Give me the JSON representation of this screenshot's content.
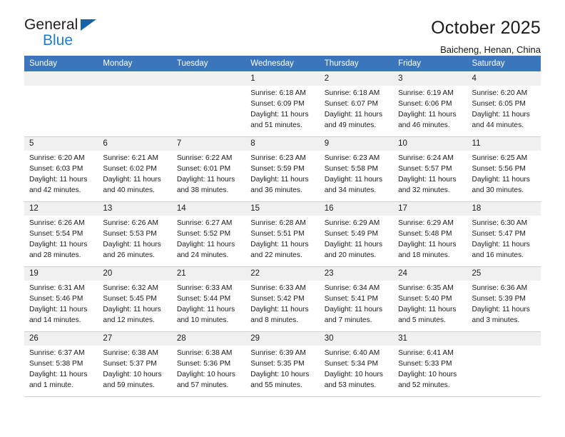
{
  "logo": {
    "line1": "General",
    "line2": "Blue",
    "triangle_icon": "triangle-icon"
  },
  "header": {
    "title": "October 2025",
    "subtitle": "Baicheng, Henan, China"
  },
  "colors": {
    "header_blue": "#3b76bc",
    "logo_blue": "#1b7fd4",
    "daynum_band": "#f0f0f0",
    "cell_border": "#cfcfcf"
  },
  "weekday_headers": [
    "Sunday",
    "Monday",
    "Tuesday",
    "Wednesday",
    "Thursday",
    "Friday",
    "Saturday"
  ],
  "weeks": [
    [
      {
        "empty": true
      },
      {
        "empty": true
      },
      {
        "empty": true
      },
      {
        "day": "1",
        "sunrise": "Sunrise: 6:18 AM",
        "sunset": "Sunset: 6:09 PM",
        "daylight": "Daylight: 11 hours and 51 minutes."
      },
      {
        "day": "2",
        "sunrise": "Sunrise: 6:18 AM",
        "sunset": "Sunset: 6:07 PM",
        "daylight": "Daylight: 11 hours and 49 minutes."
      },
      {
        "day": "3",
        "sunrise": "Sunrise: 6:19 AM",
        "sunset": "Sunset: 6:06 PM",
        "daylight": "Daylight: 11 hours and 46 minutes."
      },
      {
        "day": "4",
        "sunrise": "Sunrise: 6:20 AM",
        "sunset": "Sunset: 6:05 PM",
        "daylight": "Daylight: 11 hours and 44 minutes."
      }
    ],
    [
      {
        "day": "5",
        "sunrise": "Sunrise: 6:20 AM",
        "sunset": "Sunset: 6:03 PM",
        "daylight": "Daylight: 11 hours and 42 minutes."
      },
      {
        "day": "6",
        "sunrise": "Sunrise: 6:21 AM",
        "sunset": "Sunset: 6:02 PM",
        "daylight": "Daylight: 11 hours and 40 minutes."
      },
      {
        "day": "7",
        "sunrise": "Sunrise: 6:22 AM",
        "sunset": "Sunset: 6:01 PM",
        "daylight": "Daylight: 11 hours and 38 minutes."
      },
      {
        "day": "8",
        "sunrise": "Sunrise: 6:23 AM",
        "sunset": "Sunset: 5:59 PM",
        "daylight": "Daylight: 11 hours and 36 minutes."
      },
      {
        "day": "9",
        "sunrise": "Sunrise: 6:23 AM",
        "sunset": "Sunset: 5:58 PM",
        "daylight": "Daylight: 11 hours and 34 minutes."
      },
      {
        "day": "10",
        "sunrise": "Sunrise: 6:24 AM",
        "sunset": "Sunset: 5:57 PM",
        "daylight": "Daylight: 11 hours and 32 minutes."
      },
      {
        "day": "11",
        "sunrise": "Sunrise: 6:25 AM",
        "sunset": "Sunset: 5:56 PM",
        "daylight": "Daylight: 11 hours and 30 minutes."
      }
    ],
    [
      {
        "day": "12",
        "sunrise": "Sunrise: 6:26 AM",
        "sunset": "Sunset: 5:54 PM",
        "daylight": "Daylight: 11 hours and 28 minutes."
      },
      {
        "day": "13",
        "sunrise": "Sunrise: 6:26 AM",
        "sunset": "Sunset: 5:53 PM",
        "daylight": "Daylight: 11 hours and 26 minutes."
      },
      {
        "day": "14",
        "sunrise": "Sunrise: 6:27 AM",
        "sunset": "Sunset: 5:52 PM",
        "daylight": "Daylight: 11 hours and 24 minutes."
      },
      {
        "day": "15",
        "sunrise": "Sunrise: 6:28 AM",
        "sunset": "Sunset: 5:51 PM",
        "daylight": "Daylight: 11 hours and 22 minutes."
      },
      {
        "day": "16",
        "sunrise": "Sunrise: 6:29 AM",
        "sunset": "Sunset: 5:49 PM",
        "daylight": "Daylight: 11 hours and 20 minutes."
      },
      {
        "day": "17",
        "sunrise": "Sunrise: 6:29 AM",
        "sunset": "Sunset: 5:48 PM",
        "daylight": "Daylight: 11 hours and 18 minutes."
      },
      {
        "day": "18",
        "sunrise": "Sunrise: 6:30 AM",
        "sunset": "Sunset: 5:47 PM",
        "daylight": "Daylight: 11 hours and 16 minutes."
      }
    ],
    [
      {
        "day": "19",
        "sunrise": "Sunrise: 6:31 AM",
        "sunset": "Sunset: 5:46 PM",
        "daylight": "Daylight: 11 hours and 14 minutes."
      },
      {
        "day": "20",
        "sunrise": "Sunrise: 6:32 AM",
        "sunset": "Sunset: 5:45 PM",
        "daylight": "Daylight: 11 hours and 12 minutes."
      },
      {
        "day": "21",
        "sunrise": "Sunrise: 6:33 AM",
        "sunset": "Sunset: 5:44 PM",
        "daylight": "Daylight: 11 hours and 10 minutes."
      },
      {
        "day": "22",
        "sunrise": "Sunrise: 6:33 AM",
        "sunset": "Sunset: 5:42 PM",
        "daylight": "Daylight: 11 hours and 8 minutes."
      },
      {
        "day": "23",
        "sunrise": "Sunrise: 6:34 AM",
        "sunset": "Sunset: 5:41 PM",
        "daylight": "Daylight: 11 hours and 7 minutes."
      },
      {
        "day": "24",
        "sunrise": "Sunrise: 6:35 AM",
        "sunset": "Sunset: 5:40 PM",
        "daylight": "Daylight: 11 hours and 5 minutes."
      },
      {
        "day": "25",
        "sunrise": "Sunrise: 6:36 AM",
        "sunset": "Sunset: 5:39 PM",
        "daylight": "Daylight: 11 hours and 3 minutes."
      }
    ],
    [
      {
        "day": "26",
        "sunrise": "Sunrise: 6:37 AM",
        "sunset": "Sunset: 5:38 PM",
        "daylight": "Daylight: 11 hours and 1 minute."
      },
      {
        "day": "27",
        "sunrise": "Sunrise: 6:38 AM",
        "sunset": "Sunset: 5:37 PM",
        "daylight": "Daylight: 10 hours and 59 minutes."
      },
      {
        "day": "28",
        "sunrise": "Sunrise: 6:38 AM",
        "sunset": "Sunset: 5:36 PM",
        "daylight": "Daylight: 10 hours and 57 minutes."
      },
      {
        "day": "29",
        "sunrise": "Sunrise: 6:39 AM",
        "sunset": "Sunset: 5:35 PM",
        "daylight": "Daylight: 10 hours and 55 minutes."
      },
      {
        "day": "30",
        "sunrise": "Sunrise: 6:40 AM",
        "sunset": "Sunset: 5:34 PM",
        "daylight": "Daylight: 10 hours and 53 minutes."
      },
      {
        "day": "31",
        "sunrise": "Sunrise: 6:41 AM",
        "sunset": "Sunset: 5:33 PM",
        "daylight": "Daylight: 10 hours and 52 minutes."
      },
      {
        "empty": true
      }
    ]
  ]
}
